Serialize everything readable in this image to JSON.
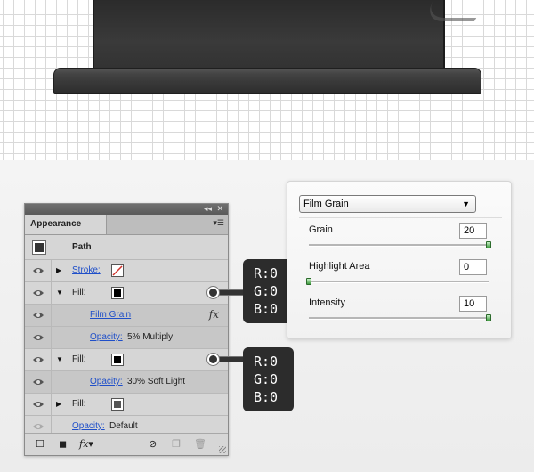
{
  "panel": {
    "tab_label": "Appearance",
    "path_label": "Path",
    "rows": [
      {
        "kind": "stroke",
        "label": "Stroke:"
      },
      {
        "kind": "fill",
        "label": "Fill:"
      },
      {
        "kind": "effect",
        "label": "Film Grain"
      },
      {
        "kind": "opacity",
        "label": "Opacity:",
        "value": "5% Multiply"
      },
      {
        "kind": "fill",
        "label": "Fill:"
      },
      {
        "kind": "opacity",
        "label": "Opacity:",
        "value": "30% Soft Light"
      },
      {
        "kind": "fill",
        "label": "Fill:"
      },
      {
        "kind": "opacity",
        "label": "Opacity:",
        "value": "Default"
      }
    ],
    "footer": {
      "fx_label": "fx"
    }
  },
  "callouts": [
    {
      "r": "R:0",
      "g": "G:0",
      "b": "B:0"
    },
    {
      "r": "R:0",
      "g": "G:0",
      "b": "B:0"
    }
  ],
  "dialog": {
    "filter": "Film Grain",
    "fields": [
      {
        "label": "Grain",
        "value": "20",
        "level": 1.0
      },
      {
        "label": "Highlight Area",
        "value": "0",
        "level": 0.0
      },
      {
        "label": "Intensity",
        "value": "10",
        "level": 1.0
      }
    ]
  },
  "colors": {
    "stroke_none": "#d0302a",
    "fill": "#000000",
    "fill_grey": "#555555",
    "link": "#1f4fc9"
  }
}
